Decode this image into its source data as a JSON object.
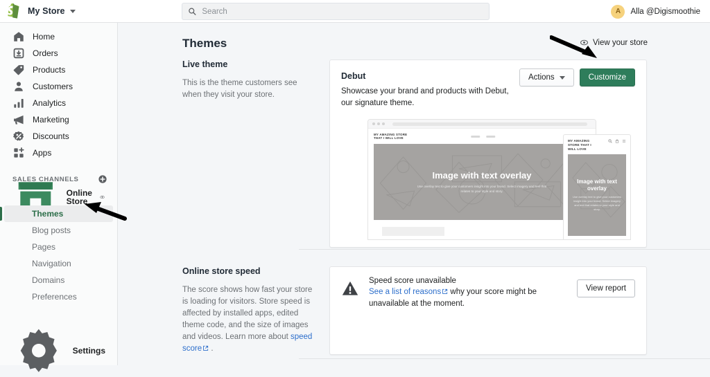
{
  "topbar": {
    "store_name": "My Store",
    "search_placeholder": "Search",
    "search_value": "",
    "avatar_initial": "A",
    "user_name": "Alla @Digismoothie"
  },
  "sidebar": {
    "nav_items": [
      {
        "label": "Home",
        "icon": "home-icon"
      },
      {
        "label": "Orders",
        "icon": "orders-icon"
      },
      {
        "label": "Products",
        "icon": "products-tag-icon"
      },
      {
        "label": "Customers",
        "icon": "customers-icon"
      },
      {
        "label": "Analytics",
        "icon": "analytics-bars-icon"
      },
      {
        "label": "Marketing",
        "icon": "marketing-megaphone-icon"
      },
      {
        "label": "Discounts",
        "icon": "discounts-icon"
      },
      {
        "label": "Apps",
        "icon": "apps-icon"
      }
    ],
    "sales_channels_label": "SALES CHANNELS",
    "channel": {
      "label": "Online Store",
      "icon": "storefront-icon"
    },
    "sub_items": [
      {
        "label": "Themes",
        "active": true
      },
      {
        "label": "Blog posts",
        "active": false
      },
      {
        "label": "Pages",
        "active": false
      },
      {
        "label": "Navigation",
        "active": false
      },
      {
        "label": "Domains",
        "active": false
      },
      {
        "label": "Preferences",
        "active": false
      }
    ],
    "settings_label": "Settings"
  },
  "main": {
    "page_title": "Themes",
    "view_store_label": "View your store",
    "live_theme": {
      "heading": "Live theme",
      "description": "This is the theme customers see when they visit your store.",
      "theme_name": "Debut",
      "theme_description": "Showcase your brand and products with Debut, our signature theme.",
      "actions_label": "Actions",
      "customize_label": "Customize"
    },
    "preview": {
      "store_logo_line1": "MY AMAZING STORE",
      "store_logo_line2": "THAT I WILL LOVE",
      "mobile_logo_line1": "MY AMAZING",
      "mobile_logo_line2": "STORE THAT I",
      "mobile_logo_line3": "WILL LOVE",
      "hero_title": "Image with text overlay",
      "hero_subtitle": "Use overlay text to give your customers insight into your brand. Select imagery and text that relates to your style and story."
    },
    "store_speed": {
      "heading": "Online store speed",
      "description_part1": "The score shows how fast your store is loading for visitors. Store speed is affected by installed apps, edited theme code, and the size of images and videos. Learn more about ",
      "link_label": "speed score",
      "description_part2": " .",
      "card_title": "Speed score unavailable",
      "card_link": "See a list of reasons",
      "card_text": " why your score might be unavailable at the moment.",
      "view_report_label": "View report"
    }
  },
  "colors": {
    "brand_green": "#2e7d5b",
    "active_green": "#2c6e49",
    "link_blue": "#2c6ecb",
    "avatar_yellow": "#f6d27d"
  }
}
